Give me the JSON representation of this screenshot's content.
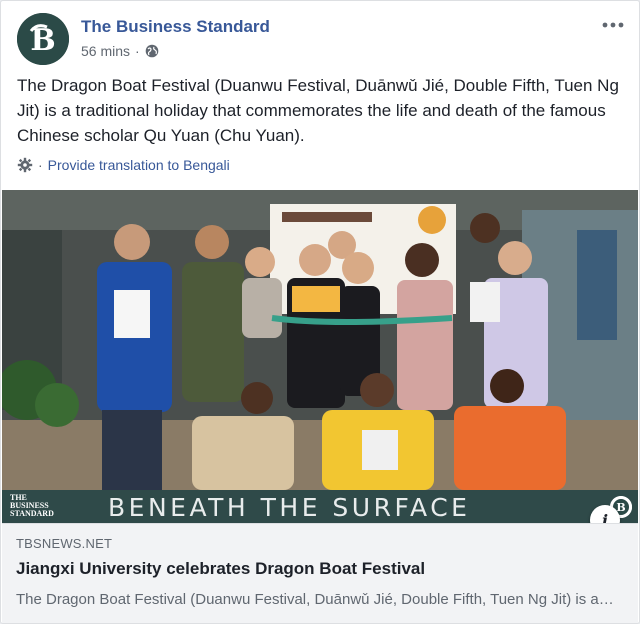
{
  "post": {
    "page_name": "The Business Standard",
    "time": "56 mins",
    "separator": "·",
    "text": "The Dragon Boat Festival (Duanwu Festival, Duānwǔ Jié, Double Fifth, Tuen Ng Jit) is a traditional holiday that commemorates the life and death of the famous Chinese scholar Qu Yuan (Chu Yuan).",
    "translate_separator": "·",
    "translate_label": "Provide translation to Bengali",
    "more_icon": "more-horizontal-icon",
    "privacy_icon": "globe-icon"
  },
  "image": {
    "description_icon": "group-photo",
    "logo_line1": "THE",
    "logo_line2": "BUSINESS",
    "logo_line3": "STANDARD",
    "banner_text": "BENEATH THE SURFACE",
    "info_label": "i"
  },
  "link": {
    "domain": "TBSNEWS.NET",
    "title": "Jiangxi University celebrates Dragon Boat Festival",
    "description": "The Dragon Boat Festival (Duanwu Festival, Duānwǔ Jié, Double Fifth, Tuen Ng Jit) is a traditional holiday that commemorates..."
  },
  "colors": {
    "link_blue": "#385898",
    "brand_teal": "#2b4a47",
    "meta_gray": "#606770",
    "footer_bg": "#f2f3f5"
  }
}
